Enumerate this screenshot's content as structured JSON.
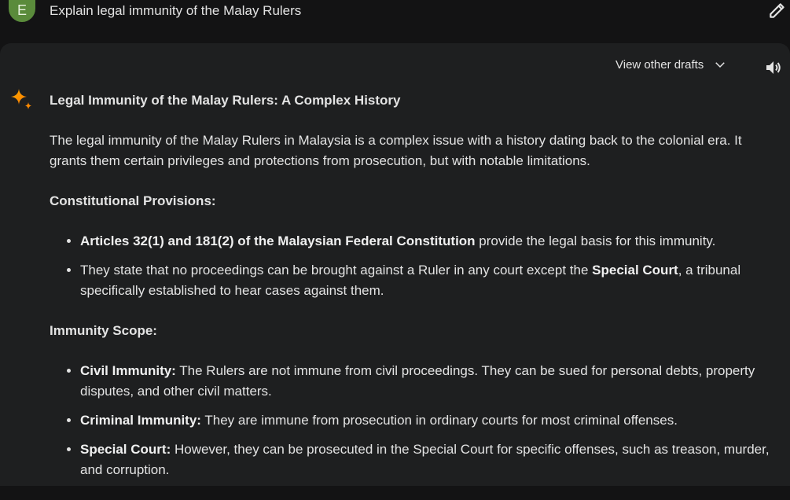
{
  "prompt": {
    "avatar_letter": "E",
    "text": "Explain legal immunity of the Malay Rulers"
  },
  "toolbar": {
    "view_drafts": "View other drafts"
  },
  "icons": {
    "edit": "pencil-icon",
    "drafts_toggle": "chevron-down-icon",
    "speaker": "speaker-icon",
    "model": "sparkle-icon"
  },
  "response": {
    "title": "Legal Immunity of the Malay Rulers: A Complex History",
    "intro": "The legal immunity of the Malay Rulers in Malaysia is a complex issue with a history dating back to the colonial era. It grants them certain privileges and protections from prosecution, but with notable limitations.",
    "sections": [
      {
        "heading": "Constitutional Provisions:",
        "items": [
          {
            "bold": "Articles 32(1) and 181(2) of the Malaysian Federal Constitution",
            "text": " provide the legal basis for this immunity."
          },
          {
            "pre": "They state that no proceedings can be brought against a Ruler in any court except the ",
            "bold": "Special Court",
            "text": ", a tribunal specifically established to hear cases against them."
          }
        ]
      },
      {
        "heading": "Immunity Scope:",
        "items": [
          {
            "bold": "Civil Immunity:",
            "text": " The Rulers are not immune from civil proceedings. They can be sued for personal debts, property disputes, and other civil matters."
          },
          {
            "bold": "Criminal Immunity:",
            "text": " They are immune from prosecution in ordinary courts for most criminal offenses."
          },
          {
            "bold": "Special Court:",
            "text": " However, they can be prosecuted in the Special Court for specific offenses, such as treason, murder, and corruption."
          }
        ]
      }
    ]
  },
  "colors": {
    "background": "#131314",
    "surface": "#1e1f20",
    "text": "#e3e3e3",
    "avatar": "#5a8b3b"
  }
}
